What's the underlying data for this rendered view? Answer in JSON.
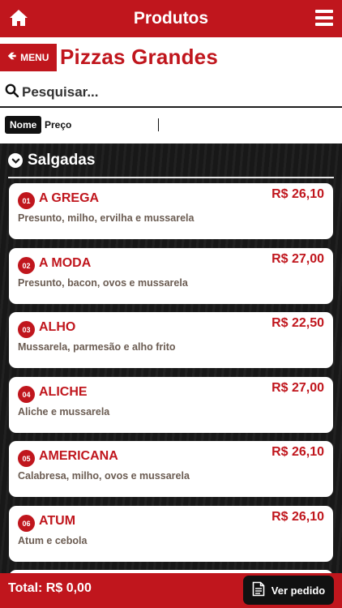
{
  "topbar": {
    "title": "Produtos",
    "home_icon": "home-icon",
    "menu_icon": "hamburger-menu-icon"
  },
  "header": {
    "back_label": "MENU",
    "back_icon": "arrow-left-icon",
    "title": "Pizzas Grandes"
  },
  "search": {
    "placeholder": "Pesquisar...",
    "value": "",
    "icon": "search-icon"
  },
  "sort": {
    "name_label": "Nome",
    "price_label": "Preço",
    "active": "Nome"
  },
  "section": {
    "label": "Salgadas",
    "icon": "chevron-down-circle-icon"
  },
  "products": [
    {
      "num": "01",
      "name": "A GREGA",
      "price": "R$ 26,10",
      "desc": "Presunto, milho, ervilha e mussarela"
    },
    {
      "num": "02",
      "name": "A MODA",
      "price": "R$ 27,00",
      "desc": "Presunto, bacon, ovos e mussarela"
    },
    {
      "num": "03",
      "name": "ALHO",
      "price": "R$ 22,50",
      "desc": "Mussarela, parmesão e alho frito"
    },
    {
      "num": "04",
      "name": "ALICHE",
      "price": "R$ 27,00",
      "desc": "Aliche e mussarela"
    },
    {
      "num": "05",
      "name": "AMERICANA",
      "price": "R$ 26,10",
      "desc": "Calabresa, milho, ovos e mussarela"
    },
    {
      "num": "06",
      "name": "ATUM",
      "price": "R$ 26,10",
      "desc": "Atum e cebola"
    }
  ],
  "footer": {
    "total": "Total: R$ 0,00",
    "order_label": "Ver pedido",
    "order_icon": "document-icon"
  },
  "colors": {
    "brand": "#c0161d",
    "dark": "#111111",
    "desc": "#6b5c52"
  }
}
